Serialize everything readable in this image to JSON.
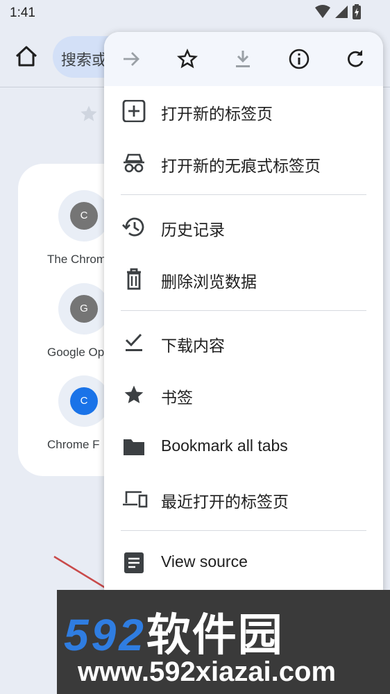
{
  "status": {
    "time": "1:41"
  },
  "toolbar": {
    "omnibox_text": "搜索或输入网址"
  },
  "tiles": [
    {
      "letter": "C",
      "label": "The Chrome",
      "color": "#757575"
    },
    {
      "letter": "G",
      "label": "Google Op",
      "color": "#757575"
    },
    {
      "letter": "C",
      "label": "Chrome F",
      "color": "#1a73e8"
    }
  ],
  "menu": {
    "top_icons": [
      "forward-icon",
      "star-icon",
      "download-icon",
      "info-icon",
      "refresh-icon"
    ],
    "items": [
      {
        "label": "打开新的标签页",
        "icon": "new-tab-icon"
      },
      {
        "label": "打开新的无痕式标签页",
        "icon": "incognito-icon"
      },
      {
        "label": "历史记录",
        "icon": "history-icon"
      },
      {
        "label": "删除浏览数据",
        "icon": "trash-icon"
      },
      {
        "label": "下载内容",
        "icon": "downloads-icon"
      },
      {
        "label": "书签",
        "icon": "bookmark-star-icon"
      },
      {
        "label": "Bookmark all tabs",
        "icon": "folder-icon"
      },
      {
        "label": "最近打开的标签页",
        "icon": "devices-icon"
      },
      {
        "label": "View source",
        "icon": "source-icon"
      }
    ]
  },
  "watermark": {
    "brand_number": "592",
    "brand_cn": "软件园",
    "url": "www.592xiazai.com"
  },
  "colors": {
    "accent": "#1a73e8",
    "omnibox_bg": "#d3e0f7",
    "page_bg": "#e8ecf4"
  }
}
